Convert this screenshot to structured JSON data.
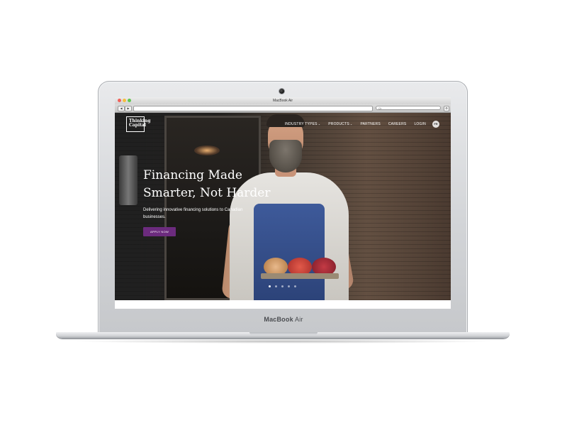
{
  "device": {
    "bezel_label_bold": "MacBook",
    "bezel_label_light": "Air",
    "window_title": "MacBook Air"
  },
  "browser": {
    "search_placeholder": "Q•"
  },
  "site": {
    "logo_text_line1": "Thinking",
    "logo_text_line2": "Capital",
    "nav": [
      {
        "label": "INDUSTRY TYPES",
        "has_dropdown": true
      },
      {
        "label": "PRODUCTS",
        "has_dropdown": true
      },
      {
        "label": "PARTNERS",
        "has_dropdown": false
      },
      {
        "label": "CAREERS",
        "has_dropdown": false
      },
      {
        "label": "LOGIN",
        "has_dropdown": false
      }
    ],
    "lang_label": "FR",
    "hero": {
      "title": "Financing Made Smarter, Not Harder",
      "subtitle": "Delivering innovative financing solutions to Canadian businesses.",
      "cta": "APPLY NOW"
    },
    "carousel": {
      "count": 5,
      "active_index": 0
    }
  },
  "colors": {
    "cta_purple": "#6c2b7e",
    "apron_blue": "#3e5a9a"
  }
}
